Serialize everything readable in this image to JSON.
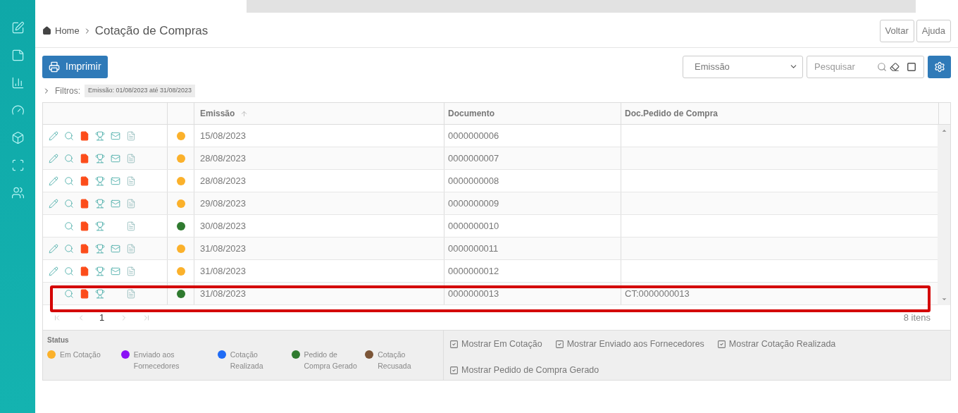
{
  "breadcrumb": {
    "home": "Home",
    "current": "Cotação de Compras"
  },
  "header_buttons": [
    "Voltar",
    "Ajuda"
  ],
  "toolbar": {
    "print_button": "Imprimir",
    "sort_select": "Emissão",
    "search": {
      "placeholder": "Pesquisar",
      "toggle_checked": false
    }
  },
  "filters": {
    "label": "Filtros:",
    "tags": [
      "Emissão: 01/08/2023 até 31/08/2023"
    ]
  },
  "table": {
    "columns": [
      "Emissão",
      "Documento",
      "Doc.Pedido de Compra"
    ],
    "rows": [
      {
        "editable": true,
        "color": "#fbb12b",
        "emissao": "15/08/2023",
        "documento": "0000000006",
        "pedido": "",
        "highlighted": false
      },
      {
        "editable": true,
        "color": "#fbb12b",
        "emissao": "28/08/2023",
        "documento": "0000000007",
        "pedido": "",
        "highlighted": false
      },
      {
        "editable": true,
        "color": "#fbb12b",
        "emissao": "28/08/2023",
        "documento": "0000000008",
        "pedido": "",
        "highlighted": false
      },
      {
        "editable": true,
        "color": "#fbb12b",
        "emissao": "29/08/2023",
        "documento": "0000000009",
        "pedido": "",
        "highlighted": false
      },
      {
        "editable": false,
        "color": "#2f7a2f",
        "emissao": "30/08/2023",
        "documento": "0000000010",
        "pedido": "",
        "highlighted": false
      },
      {
        "editable": true,
        "color": "#fbb12b",
        "emissao": "31/08/2023",
        "documento": "0000000011",
        "pedido": "",
        "highlighted": false
      },
      {
        "editable": true,
        "color": "#fbb12b",
        "emissao": "31/08/2023",
        "documento": "0000000012",
        "pedido": "",
        "highlighted": false
      },
      {
        "editable": false,
        "color": "#2f7a2f",
        "emissao": "31/08/2023",
        "documento": "0000000013",
        "pedido": "CT:0000000013",
        "highlighted": true
      }
    ]
  },
  "pagination": {
    "page": "1",
    "count": "8 itens"
  },
  "legend": {
    "title": "Status",
    "items": [
      {
        "label": "Em Cotação",
        "color": "#fbb12b"
      },
      {
        "label": "Enviado aos Fornecedores",
        "color": "#8a12f5"
      },
      {
        "label": "Cotação Realizada",
        "color": "#1f6bf5"
      },
      {
        "label": "Pedido de Compra Gerado",
        "color": "#2f7a2f"
      },
      {
        "label": "Cotação Recusada",
        "color": "#7b5537"
      }
    ]
  },
  "filters_checkboxes": [
    {
      "label": "Mostrar Em Cotação",
      "checked": true
    },
    {
      "label": "Mostrar Enviado aos Fornecedores",
      "checked": true
    },
    {
      "label": "Mostrar Cotação Realizada",
      "checked": true
    },
    {
      "label": "Mostrar Pedido de Compra Gerado",
      "checked": true
    }
  ]
}
